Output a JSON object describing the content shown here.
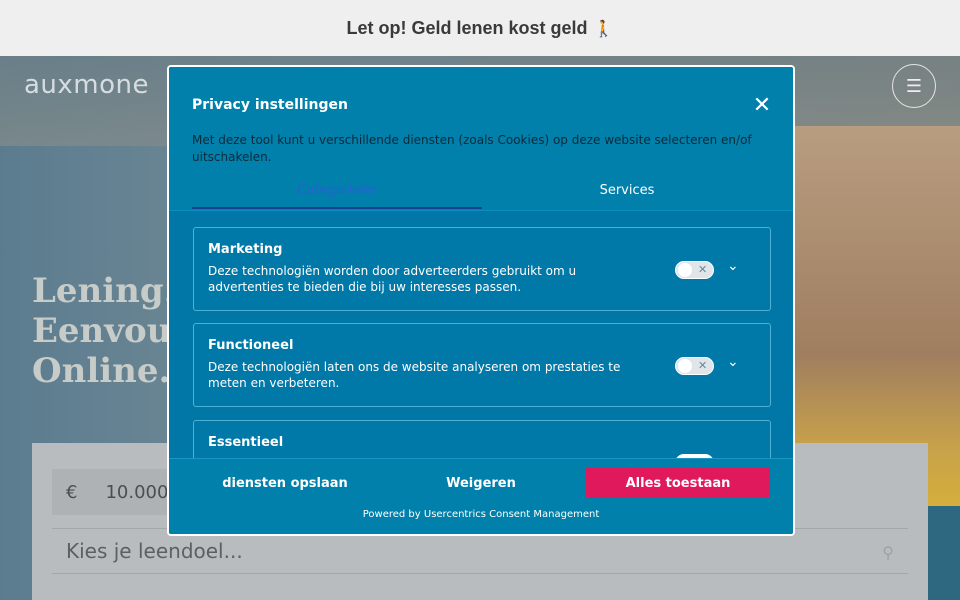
{
  "banner": {
    "text": "Let op! Geld lenen kost geld",
    "icon": "walking-person-icon"
  },
  "page": {
    "logo": "auxmone",
    "headline": [
      "Lening.",
      "Eenvou",
      "Online."
    ],
    "amount_currency": "€",
    "amount_value": "10.000",
    "goal_placeholder": "Kies je leendoel..."
  },
  "modal": {
    "title": "Privacy instellingen",
    "close": "✕",
    "description": "Met deze tool kunt u verschillende diensten (zoals Cookies) op deze website selecteren en/of uitschakelen.",
    "tabs": [
      {
        "label": "Categorieën",
        "active": true
      },
      {
        "label": "Services",
        "active": false
      }
    ],
    "categories": [
      {
        "title": "Marketing",
        "description": "Deze technologiën worden door adverteerders gebruikt om u advertenties te bieden die bij uw interesses passen.",
        "enabled": false
      },
      {
        "title": "Functioneel",
        "description": "Deze technologiën laten ons de website analyseren om prestaties te meten en verbeteren.",
        "enabled": false
      },
      {
        "title": "Essentieel",
        "description": "",
        "enabled": true
      }
    ],
    "buttons": {
      "save": "diensten opslaan",
      "deny": "Weigeren",
      "accept": "Alles toestaan"
    },
    "powered_by": "Powered by Usercentrics Consent Management",
    "colors": {
      "panel": "#00739e",
      "accept": "#e0195c",
      "active_tab": "#2a5fd6"
    }
  }
}
